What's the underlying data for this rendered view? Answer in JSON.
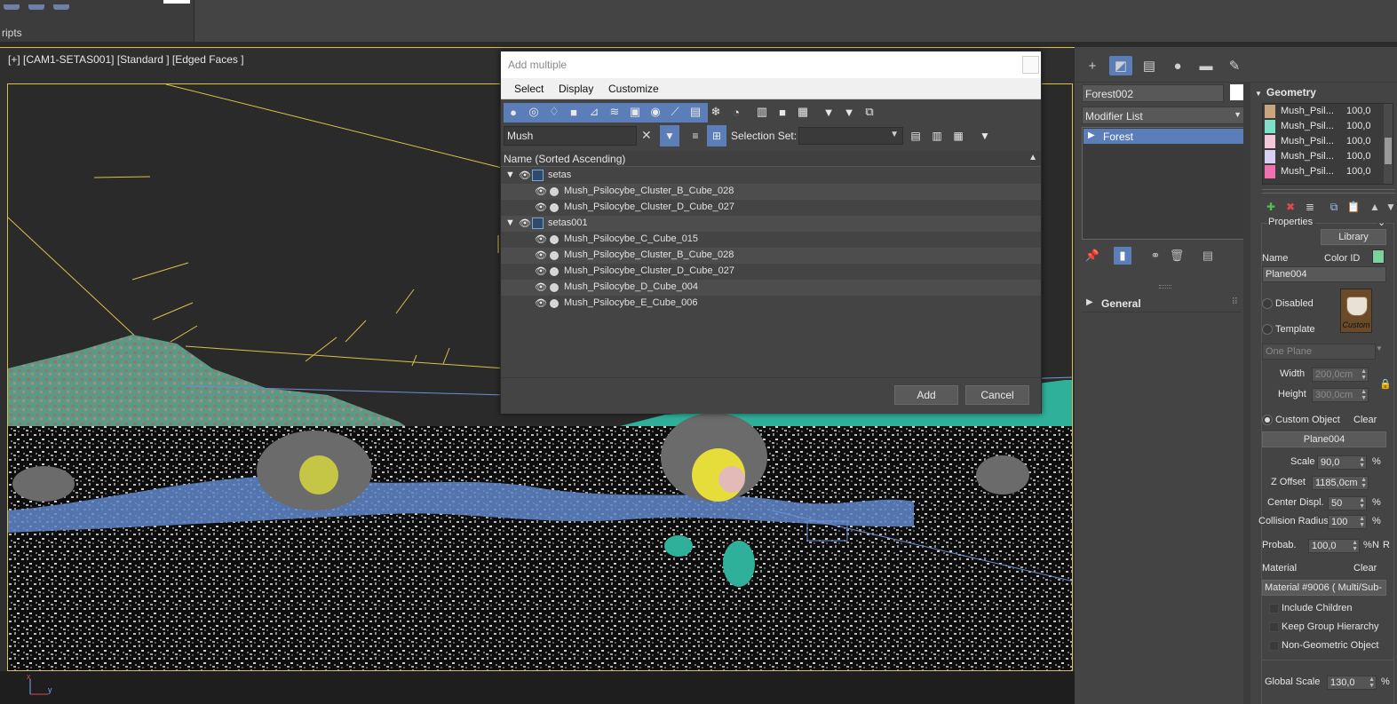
{
  "topbar": {
    "label": "ripts"
  },
  "viewport": {
    "label": "[+] [CAM1-SETAS001] [Standard ] [Edged Faces ]",
    "axis_x": "x",
    "axis_y": "y"
  },
  "dialog": {
    "title": "Add multiple",
    "menu": [
      "Select",
      "Display",
      "Customize"
    ],
    "search_value": "Mush",
    "selection_set_label": "Selection Set:",
    "selection_set_value": "",
    "column_header": "Name (Sorted Ascending)",
    "tree": [
      {
        "type": "group",
        "label": "setas"
      },
      {
        "type": "item",
        "label": "Mush_Psilocybe_Cluster_B_Cube_028"
      },
      {
        "type": "item",
        "label": "Mush_Psilocybe_Cluster_D_Cube_027"
      },
      {
        "type": "group",
        "label": "setas001"
      },
      {
        "type": "item",
        "label": "Mush_Psilocybe_C_Cube_015"
      },
      {
        "type": "item",
        "label": "Mush_Psilocybe_Cluster_B_Cube_028"
      },
      {
        "type": "item",
        "label": "Mush_Psilocybe_Cluster_D_Cube_027"
      },
      {
        "type": "item",
        "label": "Mush_Psilocybe_D_Cube_004"
      },
      {
        "type": "item",
        "label": "Mush_Psilocybe_E_Cube_006"
      }
    ],
    "add_label": "Add",
    "cancel_label": "Cancel"
  },
  "command_panel": {
    "object_name": "Forest002",
    "object_color": "#ffffff",
    "modifier_list": "Modifier List",
    "stack_item": "Forest",
    "general_rollout": "General"
  },
  "geometry": {
    "title": "Geometry",
    "items": [
      {
        "name": "Mush_Psil...",
        "value": "100,0",
        "color": "#c8a57a"
      },
      {
        "name": "Mush_Psil...",
        "value": "100,0",
        "color": "#7fe0c8"
      },
      {
        "name": "Mush_Psil...",
        "value": "100,0",
        "color": "#f2c8d8"
      },
      {
        "name": "Mush_Psil...",
        "value": "100,0",
        "color": "#d8d0f2"
      },
      {
        "name": "Mush_Psil...",
        "value": "100,0",
        "color": "#f070b0"
      }
    ]
  },
  "properties": {
    "title": "Properties",
    "library": "Library",
    "name_label": "Name",
    "color_id_label": "Color ID",
    "color_id": "#7fd0a0",
    "name_value": "Plane004",
    "disabled": "Disabled",
    "template": "Template",
    "custom_thumb_text": "Custom",
    "one_plane": "One Plane",
    "width_label": "Width",
    "width_value": "200,0cm",
    "height_label": "Height",
    "height_value": "300,0cm",
    "custom_object": "Custom Object",
    "clear": "Clear",
    "custom_object_value": "Plane004",
    "scale_label": "Scale",
    "scale_value": "90,0",
    "pct": "%",
    "zoffset_label": "Z Offset",
    "zoffset_value": "1185,0cm",
    "center_displ_label": "Center Displ.",
    "center_displ_value": "50",
    "collision_label": "Collision Radius",
    "collision_value": "100",
    "probab_label": "Probab.",
    "probab_value": "100,0",
    "n": "N",
    "r": "R",
    "material_label": "Material",
    "material_value": "Material #9006 ( Multi/Sub-",
    "include_children": "Include Children",
    "keep_group": "Keep Group Hierarchy",
    "non_geo": "Non-Geometric Object",
    "global_scale_label": "Global Scale",
    "global_scale_value": "130,0"
  }
}
